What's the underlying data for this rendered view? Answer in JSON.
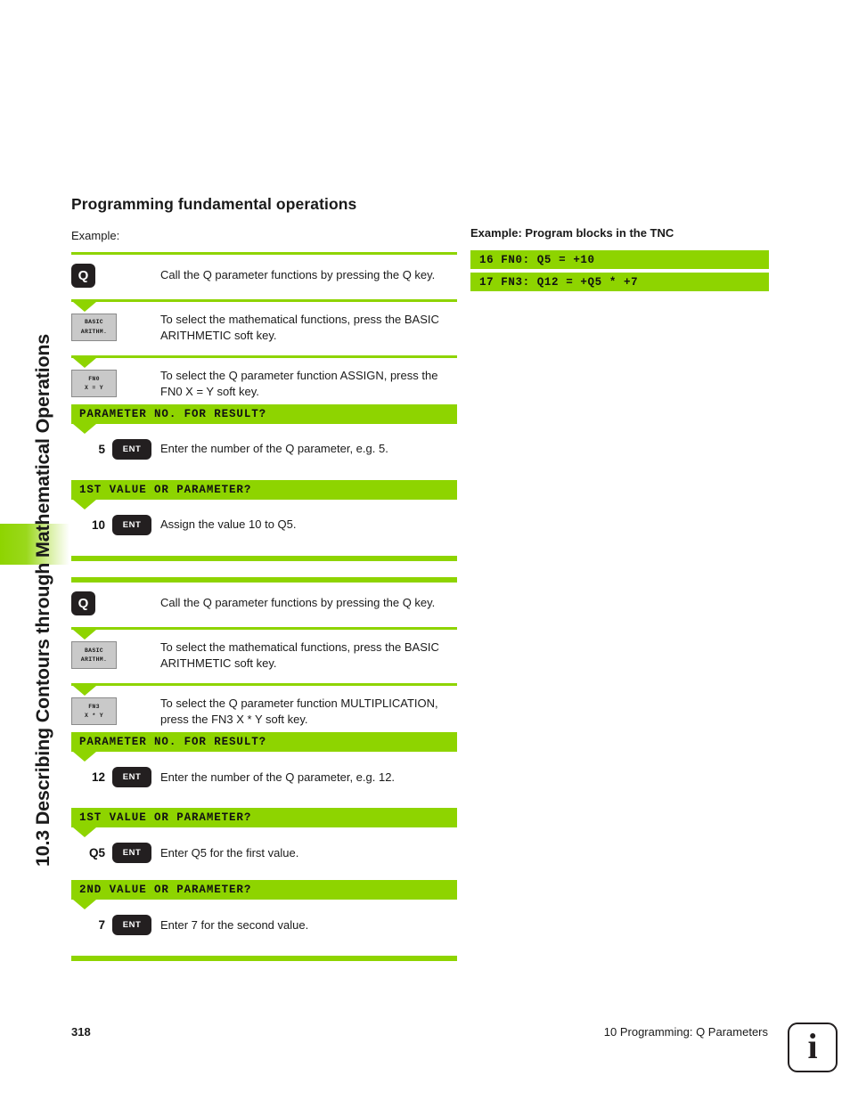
{
  "sidebar": {
    "chapter_title": "10.3 Describing Contours through Mathematical Operations"
  },
  "page": {
    "heading": "Programming fundamental operations",
    "example_label": "Example:"
  },
  "program_panel": {
    "title": "Example: Program blocks in the TNC",
    "lines": [
      "16 FN0: Q5 = +10",
      "17 FN3: Q12 = +Q5 * +7"
    ]
  },
  "steps": {
    "s1": {
      "key_label": "Q",
      "description": "Call the Q parameter functions by pressing the Q key."
    },
    "s2": {
      "softkey_line1": "BASIC",
      "softkey_line2": "ARITHM.",
      "description": "To select the mathematical functions, press the BASIC ARITHMETIC soft key."
    },
    "s3": {
      "softkey_line1": "FN0",
      "softkey_line2": "X = Y",
      "description": "To select the Q parameter function ASSIGN, press the FN0 X = Y soft key."
    },
    "p1": {
      "prompt": "PARAMETER NO. FOR RESULT?"
    },
    "s4": {
      "value": "5",
      "key_label": "ENT",
      "description": "Enter the number of the Q parameter, e.g. 5."
    },
    "p2": {
      "prompt": "1ST VALUE OR PARAMETER?"
    },
    "s5": {
      "value": "10",
      "key_label": "ENT",
      "description": "Assign the value 10 to Q5."
    },
    "s6": {
      "key_label": "Q",
      "description": "Call the Q parameter functions by pressing the Q key."
    },
    "s7": {
      "softkey_line1": "BASIC",
      "softkey_line2": "ARITHM.",
      "description": "To select the mathematical functions, press the BASIC ARITHMETIC soft key."
    },
    "s8": {
      "softkey_line1": "FN3",
      "softkey_line2": "X * Y",
      "description": "To select the Q parameter function MULTIPLICATION, press the FN3 X * Y soft key."
    },
    "p3": {
      "prompt": "PARAMETER NO. FOR RESULT?"
    },
    "s9": {
      "value": "12",
      "key_label": "ENT",
      "description": "Enter the number of the Q parameter, e.g. 12."
    },
    "p4": {
      "prompt": "1ST VALUE OR PARAMETER?"
    },
    "s10": {
      "value": "Q5",
      "key_label": "ENT",
      "description": "Enter Q5 for the first value."
    },
    "p5": {
      "prompt": "2ND VALUE OR PARAMETER?"
    },
    "s11": {
      "value": "7",
      "key_label": "ENT",
      "description": "Enter 7 for the second value."
    }
  },
  "footer": {
    "page_number": "318",
    "chapter": "10 Programming: Q Parameters",
    "info_icon": "i"
  },
  "colors": {
    "accent_green": "#8ed400",
    "dark_key": "#231f20",
    "softkey_grey": "#c9c9c9"
  }
}
